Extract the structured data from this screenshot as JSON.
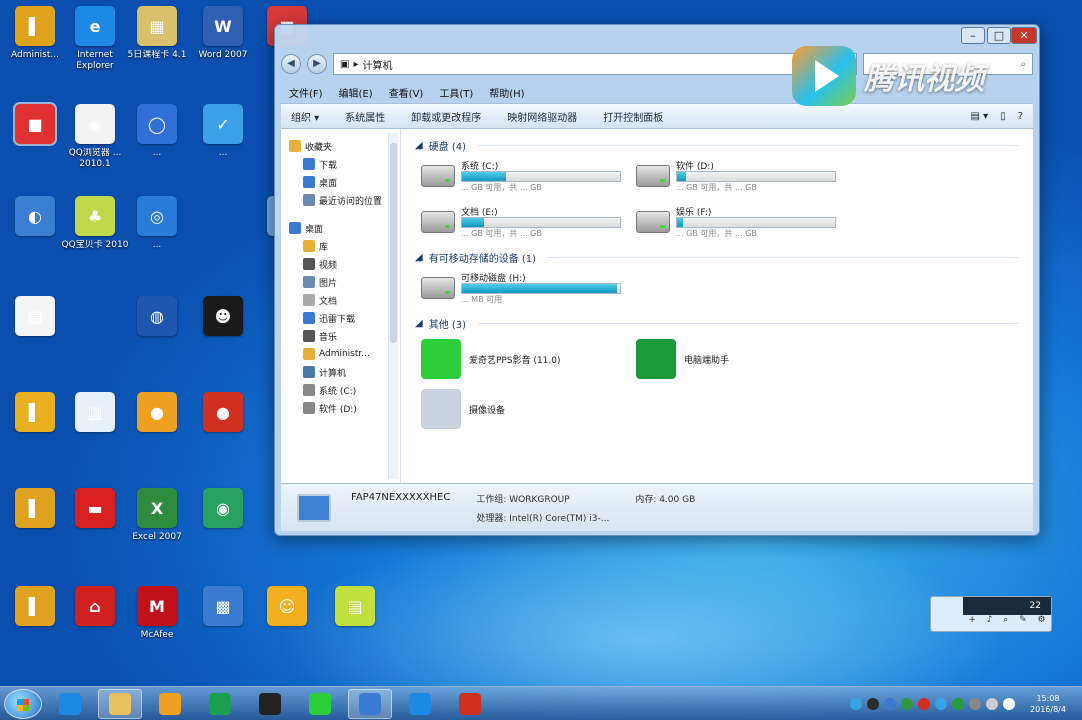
{
  "desktop_icons": [
    {
      "label": "Administ...",
      "color": "#e0a21a",
      "glyph": "▌"
    },
    {
      "label": "Internet Explorer",
      "color": "#1e88e5",
      "glyph": "e"
    },
    {
      "label": "5日课程卡 4.1",
      "color": "#d9c06a",
      "glyph": "▦"
    },
    {
      "label": "Word 2007",
      "color": "#2f5fb3",
      "glyph": "W"
    },
    {
      "label": "",
      "color": "#d83a3a",
      "glyph": "■"
    },
    {
      "label": "QQ浏览器 ... 2010.1",
      "color": "#f2f2f2",
      "glyph": "◉"
    },
    {
      "label": "...",
      "color": "#2f6fd6",
      "glyph": "◯"
    },
    {
      "label": "...",
      "color": "#3aa0e8",
      "glyph": "✓"
    },
    {
      "label": "",
      "color": "#3b7fd4",
      "glyph": "◐"
    },
    {
      "label": "QQ宝贝卡 2010",
      "color": "#c0d84a",
      "glyph": "♣"
    },
    {
      "label": "...",
      "color": "#2a7ad8",
      "glyph": "◎"
    },
    {
      "label": "",
      "color": "#6fa8d8",
      "glyph": "♺"
    },
    {
      "label": "",
      "color": "#f5f5f5",
      "glyph": "▤"
    },
    {
      "label": "",
      "color": "#1e56b0",
      "glyph": "◍"
    },
    {
      "label": "",
      "color": "#1a1a1a",
      "glyph": "☻"
    },
    {
      "label": "",
      "color": "#e8b020",
      "glyph": "▌"
    },
    {
      "label": "",
      "color": "#e8f0f8",
      "glyph": "▥"
    },
    {
      "label": "",
      "color": "#f0a020",
      "glyph": "●"
    },
    {
      "label": "",
      "color": "#d03020",
      "glyph": "●"
    },
    {
      "label": "",
      "color": "#e0a020",
      "glyph": "▌"
    },
    {
      "label": "",
      "color": "#d82020",
      "glyph": "▬"
    },
    {
      "label": "Excel 2007",
      "color": "#2e8b3e",
      "glyph": "X"
    },
    {
      "label": "",
      "color": "#28a060",
      "glyph": "◉"
    },
    {
      "label": "",
      "color": "#e0a020",
      "glyph": "▌"
    },
    {
      "label": "",
      "color": "#d02020",
      "glyph": "⌂"
    },
    {
      "label": "McAfee",
      "color": "#c0101a",
      "glyph": "M"
    },
    {
      "label": "",
      "color": "#3a7ad0",
      "glyph": "▩"
    },
    {
      "label": "",
      "color": "#f0b020",
      "glyph": "☺"
    },
    {
      "label": "",
      "color": "#c0e040",
      "glyph": "▤"
    }
  ],
  "window": {
    "address": [
      "计算机"
    ],
    "menu": [
      "文件(F)",
      "编辑(E)",
      "查看(V)",
      "工具(T)",
      "帮助(H)"
    ],
    "toolbar": [
      "组织 ▾",
      "系统属性",
      "卸载或更改程序",
      "映射网络驱动器",
      "打开控制面板"
    ],
    "nav": [
      {
        "label": "收藏夹",
        "sub": false,
        "color": "#e8b03a"
      },
      {
        "label": "下载",
        "sub": true,
        "color": "#3a7ad0"
      },
      {
        "label": "桌面",
        "sub": true,
        "color": "#3a7ad0"
      },
      {
        "label": "最近访问的位置",
        "sub": true,
        "color": "#6a8ab0"
      },
      {
        "label": "",
        "gap": true
      },
      {
        "label": "桌面",
        "sub": false,
        "color": "#3a7ad0"
      },
      {
        "label": "库",
        "sub": true,
        "color": "#e8b03a"
      },
      {
        "label": "视频",
        "sub": true,
        "color": "#555"
      },
      {
        "label": "图片",
        "sub": true,
        "color": "#6a8ab0"
      },
      {
        "label": "文档",
        "sub": true,
        "color": "#aaa"
      },
      {
        "label": "迅雷下载",
        "sub": true,
        "color": "#3a7ad0"
      },
      {
        "label": "音乐",
        "sub": true,
        "color": "#555"
      },
      {
        "label": "Administr...",
        "sub": true,
        "color": "#e8b03a"
      },
      {
        "label": "计算机",
        "sub": true,
        "color": "#4a7aa8"
      },
      {
        "label": "系统 (C:)",
        "sub": true,
        "color": "#888"
      },
      {
        "label": "软件 (D:)",
        "sub": true,
        "color": "#888"
      }
    ],
    "groups": {
      "hard_disks": "硬盘 (4)",
      "removable": "有可移动存储的设备 (1)",
      "other": "其他 (3)"
    },
    "drives": [
      {
        "name": "系统 (C:)",
        "free": "... GB 可用，共 ... GB",
        "fill": 0.28
      },
      {
        "name": "软件 (D:)",
        "free": "... GB 可用，共 ... GB",
        "fill": 0.06
      },
      {
        "name": "文档 (E:)",
        "free": "... GB 可用，共 ... GB",
        "fill": 0.14
      },
      {
        "name": "娱乐 (F:)",
        "free": "... GB 可用，共 ... GB",
        "fill": 0.04
      }
    ],
    "removable": [
      {
        "name": "可移动磁盘 (H:)",
        "free": "... MB 可用",
        "fill": 0.98
      }
    ],
    "other_items": [
      {
        "name": "爱奇艺PPS影音 (11.0)",
        "color": "#2ccf3a"
      },
      {
        "name": "电脑端助手",
        "color": "#1a9a3a"
      },
      {
        "name": "摄像设备",
        "color": "#c9d3e0"
      }
    ],
    "details": {
      "name": "FAP47NEXXXXXHEC",
      "workgroup": "工作组: WORKGROUP",
      "memory": "内存: 4.00 GB",
      "cpu": "处理器: Intel(R) Core(TM) i3-..."
    }
  },
  "watermark": {
    "text": "腾讯视频"
  },
  "widget": {
    "time": "22",
    "icons": [
      "+",
      "♪",
      "⌕",
      "✎",
      "⚙"
    ]
  },
  "taskbar": {
    "items": [
      {
        "name": "ie",
        "color": "#1e88e5"
      },
      {
        "name": "explorer-folder",
        "color": "#e8c060",
        "active": true
      },
      {
        "name": "sun-app",
        "color": "#f0a020"
      },
      {
        "name": "green-app",
        "color": "#1aa050"
      },
      {
        "name": "qq",
        "color": "#222"
      },
      {
        "name": "iqiyi",
        "color": "#2ccf3a"
      },
      {
        "name": "browser-blue",
        "color": "#3a7ad0",
        "active": true
      },
      {
        "name": "ie-2",
        "color": "#1e88e5"
      },
      {
        "name": "angry-app",
        "color": "#d03020"
      }
    ],
    "tray_colors": [
      "#3aa0e8",
      "#2a2a2a",
      "#3a7ad0",
      "#2a9a3a",
      "#d03020",
      "#3aa0e8",
      "#2a9a3a",
      "#888",
      "#ccc",
      "#fff"
    ],
    "clock_time": "15:08",
    "clock_date": "2016/8/4"
  }
}
